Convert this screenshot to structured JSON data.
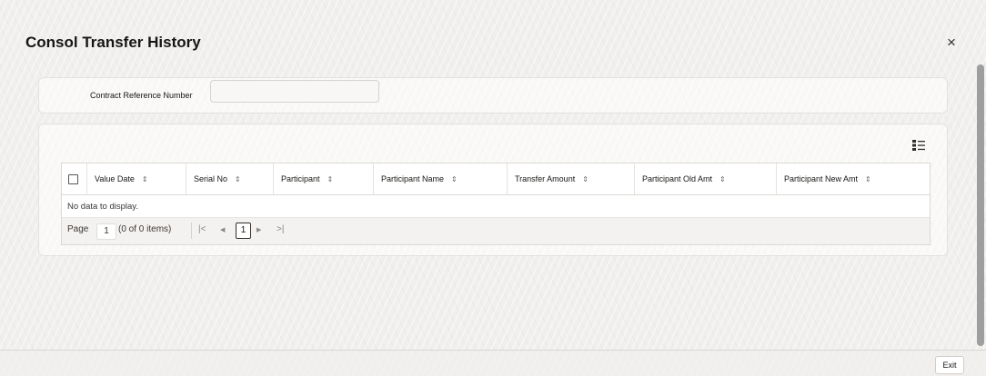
{
  "dialog": {
    "title": "Consol Transfer History",
    "close_glyph": "×",
    "exit_label": "Exit"
  },
  "filter": {
    "contract_reference_label": "Contract Reference Number",
    "contract_reference_value": ""
  },
  "grid": {
    "columns": [
      "Value Date",
      "Serial No",
      "Participant",
      "Participant Name",
      "Transfer Amount",
      "Participant Old Amt",
      "Participant New Amt"
    ],
    "sort_glyph": "⇕",
    "empty_message": "No data to display.",
    "columns_icon": "column-manager-icon"
  },
  "pagination": {
    "page_label": "Page",
    "page_value": "1",
    "item_count": "(0 of 0 items)",
    "first_glyph": "|<",
    "prev_glyph": "◀",
    "current_page": "1",
    "next_glyph": "▶",
    "last_glyph": ">|"
  }
}
